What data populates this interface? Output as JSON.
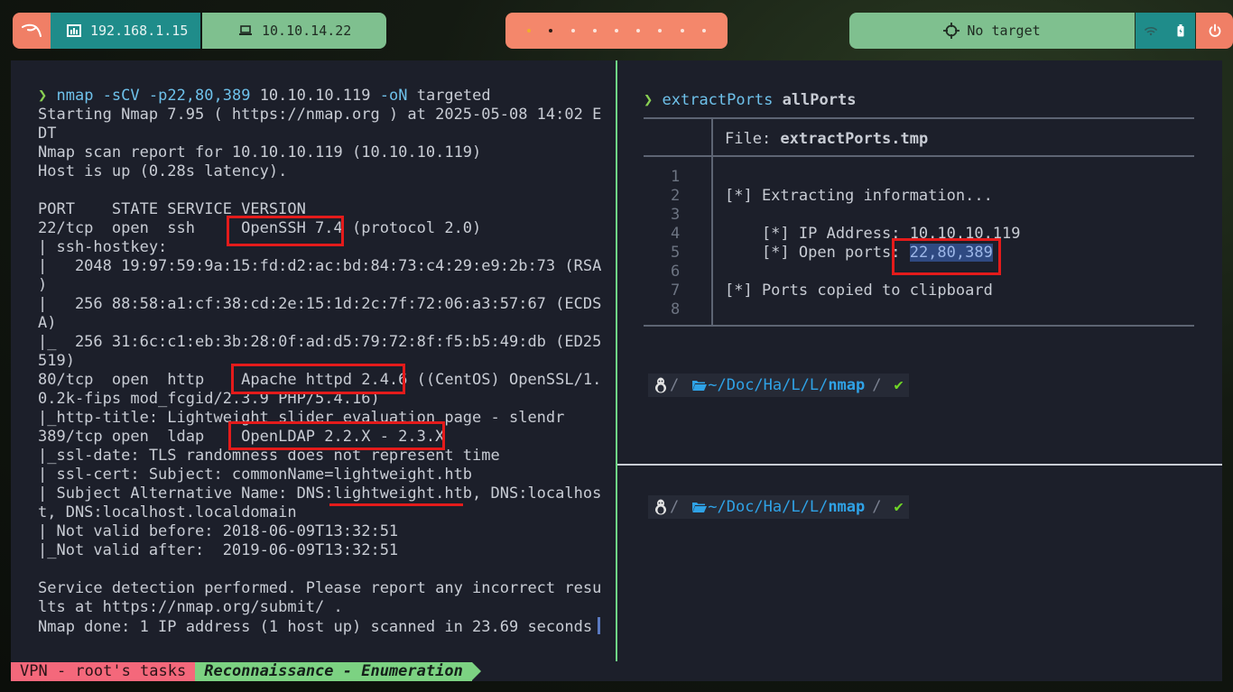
{
  "topbar": {
    "logo_icon": "kali-dragon-icon",
    "local_ip": "192.168.1.15",
    "vpn_ip": "10.10.14.22",
    "workspaces": [
      "",
      "",
      "",
      "",
      "",
      "",
      "",
      "",
      ""
    ],
    "target_label": "No target",
    "wifi_icon": "wifi-icon",
    "battery_icon": "battery-icon",
    "power_icon": "power-icon"
  },
  "left_pane": {
    "prompt": "❯",
    "command_name": "nmap",
    "command_args": " -sCV -p22,80,389",
    "command_target": " 10.10.10.119",
    "command_flag": " -oN",
    "command_file": " targeted",
    "output": "Starting Nmap 7.95 ( https://nmap.org ) at 2025-05-08 14:02 E\nDT\nNmap scan report for 10.10.10.119 (10.10.10.119)\nHost is up (0.28s latency).\n\nPORT    STATE SERVICE VERSION\n22/tcp  open  ssh     OpenSSH 7.4 (protocol 2.0)\n| ssh-hostkey:\n|   2048 19:97:59:9a:15:fd:d2:ac:bd:84:73:c4:29:e9:2b:73 (RSA\n)\n|   256 88:58:a1:cf:38:cd:2e:15:1d:2c:7f:72:06:a3:57:67 (ECDS\nA)\n|_  256 31:6c:c1:eb:3b:28:0f:ad:d5:79:72:8f:f5:b5:49:db (ED25\n519)\n80/tcp  open  http    Apache httpd 2.4.6 ((CentOS) OpenSSL/1.\n0.2k-fips mod_fcgid/2.3.9 PHP/5.4.16)\n|_http-title: Lightweight slider evaluation page - slendr\n389/tcp open  ldap    OpenLDAP 2.2.X - 2.3.X\n|_ssl-date: TLS randomness does not represent time\n| ssl-cert: Subject: commonName=lightweight.htb\n| Subject Alternative Name: DNS:lightweight.htb, DNS:localhos\nt, DNS:localhost.localdomain\n| Not valid before: 2018-06-09T13:32:51\n|_Not valid after:  2019-06-09T13:32:51\n\nService detection performed. Please report any incorrect resu\nlts at https://nmap.org/submit/ .\nNmap done: 1 IP address (1 host up) scanned in 23.69 seconds"
  },
  "right_pane": {
    "prompt": "❯",
    "command_name": "extractPorts",
    "command_arg": "allPorts",
    "file_label": "File: ",
    "file_name": "extractPorts.tmp",
    "line_numbers": "1\n2\n3\n4\n5\n6\n7\n8",
    "line_1": "",
    "line_2": "[*] Extracting information...",
    "line_3": "",
    "line_4": "    [*] IP Address: 10.10.10.119",
    "line_5_prefix": "    [*] Open ports: ",
    "line_5_ports": "22,80,389",
    "line_6": "",
    "line_7": "[*] Ports copied to clipboard",
    "line_8": ""
  },
  "zsh_prompt": {
    "os_icon": "linux-tux-icon",
    "sep": "/",
    "folder_icon": "folder-open-icon",
    "path_prefix": "~/Doc/Ha/L/L/",
    "path_last": "nmap",
    "status": "✔"
  },
  "status_bar": {
    "session": "VPN - root's tasks",
    "window": "Reconnaissance - Enumeration"
  },
  "colors": {
    "terminal_bg": "#1c1f2a",
    "accent_green": "#6fd686",
    "highlight_red": "#e41b1b",
    "topbar_teal": "#1f8c8a",
    "topbar_salmon": "#f07f66"
  }
}
